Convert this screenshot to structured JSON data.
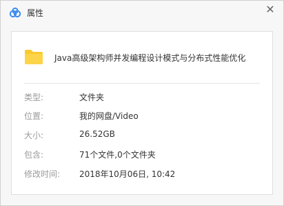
{
  "window": {
    "title": "属性",
    "close_glyph": "✕",
    "app_icon": "baidu-netdisk-icon"
  },
  "file": {
    "name": "Java高级架构师并发编程设计模式与分布式性能优化",
    "icon": "folder-icon",
    "icon_color": "#f9c930"
  },
  "properties": [
    {
      "label": "类型:",
      "value": "文件夹"
    },
    {
      "label": "位置:",
      "value": "我的网盘/Video"
    },
    {
      "label": "大小:",
      "value": "26.52GB"
    },
    {
      "label": "包含:",
      "value": "71个文件,0个文件夹"
    },
    {
      "label": "修改时间:",
      "value": "2018年10月06日, 10:42"
    }
  ]
}
